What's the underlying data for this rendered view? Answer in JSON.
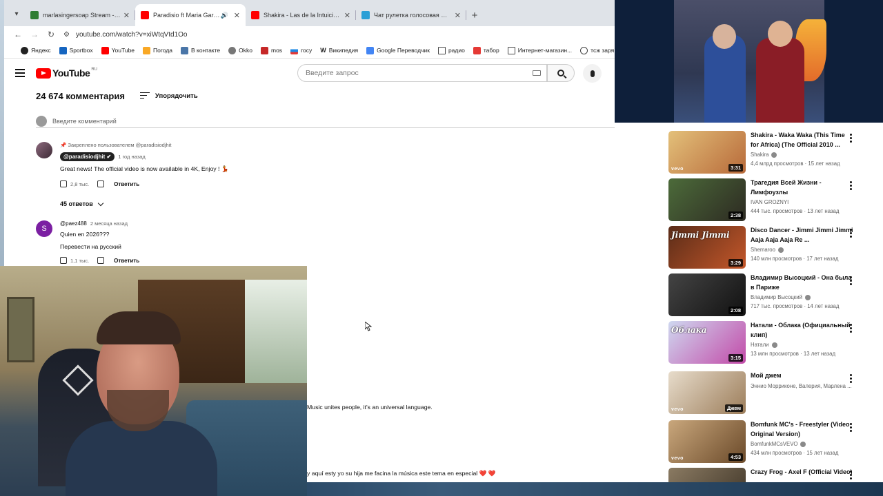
{
  "browser": {
    "tabs": [
      {
        "title": "marlasingersoap Stream - Watc",
        "favicon_color": "#2e7d32",
        "active": false
      },
      {
        "title": "Paradisio ft Maria Garcia &",
        "favicon_color": "#ff0000",
        "active": true,
        "audio": true
      },
      {
        "title": "Shakira - Las de la Intuición (Of",
        "favicon_color": "#ff0000",
        "active": false
      },
      {
        "title": "Чат рулетка голосовая — Nek",
        "favicon_color": "#2a9fd6",
        "active": false
      }
    ],
    "url": "youtube.com/watch?v=xiWtqVtd1Oo",
    "bookmarks": [
      {
        "label": "Яндекс",
        "color": "#222"
      },
      {
        "label": "Sportbox",
        "color": "#1565c0"
      },
      {
        "label": "YouTube",
        "color": "#ff0000"
      },
      {
        "label": "Погода",
        "color": "#f9a825"
      },
      {
        "label": "В контакте",
        "color": "#4a76a8"
      },
      {
        "label": "Okko",
        "color": "#555"
      },
      {
        "label": "mos",
        "color": "#c62828"
      },
      {
        "label": "госу",
        "color": "#1e88e5"
      },
      {
        "label": "Википедия",
        "color": "#fff"
      },
      {
        "label": "Google Переводчик",
        "color": "#4285f4"
      },
      {
        "label": "радио",
        "color": "#fff"
      },
      {
        "label": "табор",
        "color": "#e53935"
      },
      {
        "label": "Интернет-магазин...",
        "color": "#fff"
      },
      {
        "label": "тсж заря",
        "color": "#555"
      }
    ]
  },
  "youtube": {
    "logo_text": "YouTube",
    "logo_country": "RU",
    "search_placeholder": "Введите запрос"
  },
  "comments": {
    "count_label": "24 674 комментария",
    "sort_label": "Упорядочить",
    "add_placeholder": "Введите комментарий",
    "items": [
      {
        "pinned": "Закреплено пользователем @paradisiodjhit",
        "author": "@paradisiodjhit",
        "time": "1 год назад",
        "text": "Great news!  The official video is now available in 4K, Enjoy ! 💃",
        "likes": "2,8 тыс.",
        "reply": "Ответить",
        "avatar_color": "#6b4a5e"
      },
      {
        "author": "@paez488",
        "time": "2 месяца назад",
        "text": "Quien en 2026???",
        "translate": "Перевести на русский",
        "likes": "1,1 тыс.",
        "reply": "Ответить",
        "avatar_letter": "S",
        "avatar_color": "#7b1fa2"
      }
    ],
    "replies_toggle": "45 ответов",
    "partial_1": "Music unites people, it's an universal language.",
    "partial_2": "y aquí esty yo su hija me facina la música este tema en especial ❤️ ❤️"
  },
  "recommendations": [
    {
      "title": "Shakira - Waka Waka (This Time for Africa) (The Official 2010 ...",
      "channel": "Shakira",
      "verified": true,
      "stats": "4,4 млрд просмотров · 15 лет назад",
      "duration": "3:31",
      "vevo": "vevo",
      "thumb_from": "#e3c07a",
      "thumb_to": "#b86a3a"
    },
    {
      "title": "Трагедия Всей Жизни - Лимфоузлы",
      "channel": "IVAN GROZNYI",
      "verified": false,
      "stats": "444 тыс. просмотров · 13 лет назад",
      "duration": "2:38",
      "vevo": "",
      "thumb_from": "#4c6b3a",
      "thumb_to": "#2d2a22"
    },
    {
      "title": "Disco Dancer - Jimmi Jimmi Jimmi Aaja Aaja Aaja Re ...",
      "channel": "Shemaroo",
      "verified": true,
      "stats": "140 млн просмотров · 17 лет назад",
      "duration": "3:29",
      "vevo": "",
      "thumb_from": "#5a2c18",
      "thumb_to": "#c4572a",
      "thumb_text": "Jimmi Jimmi"
    },
    {
      "title": "Владимир Высоцкий - Она была в Париже",
      "channel": "Владимир Высоцкий",
      "verified": true,
      "stats": "717 тыс. просмотров · 14 лет назад",
      "duration": "2:08",
      "vevo": "",
      "thumb_from": "#444",
      "thumb_to": "#111"
    },
    {
      "title": "Натали - Облака (Официальный клип)",
      "channel": "Натали",
      "verified": true,
      "stats": "13 млн просмотров · 13 лет назад",
      "duration": "3:15",
      "vevo": "",
      "thumb_from": "#cfd8f0",
      "thumb_to": "#c24aa8",
      "thumb_text": "Облака"
    },
    {
      "title": "Мой джем",
      "channel": "Эннио Морриконе, Валерия, Марлена ...",
      "verified": false,
      "stats": "",
      "duration": "Джем",
      "vevo": "vevo",
      "thumb_from": "#e7dccb",
      "thumb_to": "#9c7d5a"
    },
    {
      "title": "Bomfunk MC's - Freestyler (Video Original Version)",
      "channel": "BomfunkMCsVEVO",
      "verified": true,
      "stats": "434 млн просмотров · 15 лет назад",
      "duration": "4:53",
      "vevo": "vevo",
      "thumb_from": "#c9a77c",
      "thumb_to": "#6b4a2a"
    },
    {
      "title": "Crazy Frog - Axel F (Official Video)",
      "channel": "",
      "verified": false,
      "stats": "",
      "duration": "",
      "vevo": "",
      "thumb_from": "#8a7a62",
      "thumb_to": "#3d3326"
    }
  ]
}
